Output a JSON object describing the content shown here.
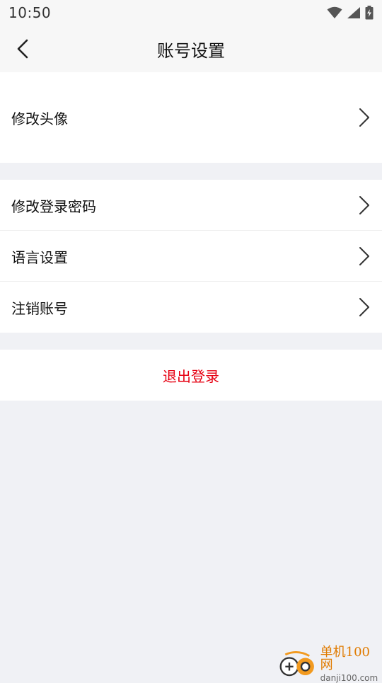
{
  "status": {
    "time": "10:50"
  },
  "header": {
    "title": "账号设置"
  },
  "groups": [
    {
      "items": [
        {
          "label": "修改头像"
        }
      ]
    },
    {
      "items": [
        {
          "label": "修改登录密码"
        },
        {
          "label": "语言设置"
        },
        {
          "label": "注销账号"
        }
      ]
    }
  ],
  "logout": {
    "label": "退出登录"
  },
  "watermark": {
    "name": "单机100网",
    "url": "danji100.com"
  },
  "colors": {
    "accent_red": "#e60012",
    "background": "#f0f1f5",
    "watermark_orange": "#e07b00"
  },
  "icons": {
    "back": "chevron-left-icon",
    "row": "chevron-right-icon",
    "wifi": "wifi-icon",
    "signal": "signal-icon",
    "battery": "battery-icon"
  }
}
